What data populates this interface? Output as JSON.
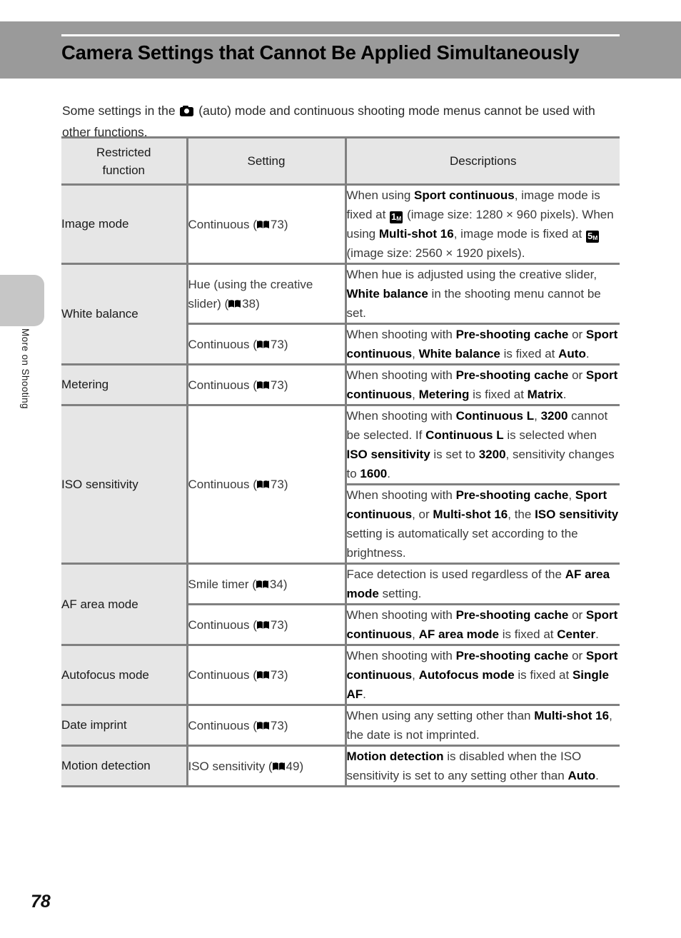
{
  "page": {
    "number": "78",
    "side_tab_label": "More on Shooting"
  },
  "header": {
    "title": "Camera Settings that Cannot Be Applied Simultaneously"
  },
  "intro": {
    "part1": "Some settings in the ",
    "icon": "camera-auto-icon",
    "part2": " (auto) mode and continuous shooting mode menus cannot be used with other functions."
  },
  "table": {
    "columns": [
      {
        "id": "restricted-function",
        "label_line1": "Restricted",
        "label_line2": "function"
      },
      {
        "id": "setting",
        "label": "Setting"
      },
      {
        "id": "descriptions",
        "label": "Descriptions"
      }
    ],
    "rows": [
      {
        "function": "Image mode",
        "entries": [
          {
            "setting": "Continuous (",
            "setting_ref": "73",
            "setting_suffix": ")",
            "description_id": "image-mode-desc"
          }
        ]
      },
      {
        "function": "White balance",
        "entries": [
          {
            "setting": "Hue (using the creative slider) (",
            "setting_ref": "38",
            "setting_suffix": ")",
            "description_id": "wb-hue-desc"
          },
          {
            "setting": "Continuous (",
            "setting_ref": "73",
            "setting_suffix": ")",
            "description_id": "wb-continuous-desc"
          }
        ]
      },
      {
        "function": "Metering",
        "entries": [
          {
            "setting": "Continuous (",
            "setting_ref": "73",
            "setting_suffix": ")",
            "description_id": "metering-desc"
          }
        ]
      },
      {
        "function": "ISO sensitivity",
        "entries": [
          {
            "setting": "Continuous (",
            "setting_ref": "73",
            "setting_suffix": ")",
            "description_id": "iso-desc-1"
          },
          {
            "description_id": "iso-desc-2"
          }
        ]
      },
      {
        "function": "AF area mode",
        "entries": [
          {
            "setting": "Smile timer (",
            "setting_ref": "34",
            "setting_suffix": ")",
            "description_id": "af-smile-desc"
          },
          {
            "setting": "Continuous (",
            "setting_ref": "73",
            "setting_suffix": ")",
            "description_id": "af-continuous-desc"
          }
        ]
      },
      {
        "function": "Autofocus mode",
        "entries": [
          {
            "setting": "Continuous (",
            "setting_ref": "73",
            "setting_suffix": ")",
            "description_id": "autofocus-desc"
          }
        ]
      },
      {
        "function": "Date imprint",
        "entries": [
          {
            "setting": "Continuous (",
            "setting_ref": "73",
            "setting_suffix": ")",
            "description_id": "date-imprint-desc"
          }
        ]
      },
      {
        "function": "Motion detection",
        "entries": [
          {
            "setting": "ISO sensitivity (",
            "setting_ref": "49",
            "setting_suffix": ")",
            "description_id": "motion-detection-desc"
          }
        ]
      }
    ]
  },
  "descriptions": {
    "image_mode": {
      "t1": "When using ",
      "b1": "Sport continuous",
      "t2": ", image mode is fixed at ",
      "badge1": "1",
      "badge1_unit": "M",
      "t3": " (image size: 1280 × 960 pixels). When using ",
      "b2": "Multi-shot 16",
      "t4": ", image mode is fixed at ",
      "badge2": "5",
      "badge2_unit": "M",
      "t5": " (image size: 2560 × 1920 pixels)."
    },
    "wb_hue": {
      "t1": "When hue is adjusted using the creative slider, ",
      "b1": "White balance",
      "t2": " in the shooting menu cannot be set."
    },
    "wb_continuous": {
      "t1": "When shooting with ",
      "b1": "Pre-shooting cache",
      "t2": " or ",
      "b2": "Sport continuous",
      "t3": ", ",
      "b3": "White balance",
      "t4": " is fixed at ",
      "b4": "Auto",
      "t5": "."
    },
    "metering": {
      "t1": "When shooting with ",
      "b1": "Pre-shooting cache",
      "t2": " or ",
      "b2": "Sport continuous",
      "t3": ", ",
      "b3": "Metering",
      "t4": " is fixed at ",
      "b4": "Matrix",
      "t5": "."
    },
    "iso_1": {
      "t1": "When shooting with ",
      "b1": "Continuous L",
      "t2": ", ",
      "b2": "3200",
      "t3": " cannot be selected. If ",
      "b3": "Continuous L",
      "t4": " is selected when ",
      "b4": "ISO sensitivity",
      "t5": " is set to ",
      "b5": "3200",
      "t6": ", sensitivity changes to ",
      "b6": "1600",
      "t7": "."
    },
    "iso_2": {
      "t1": "When shooting with ",
      "b1": "Pre-shooting cache",
      "t2": ", ",
      "b2": "Sport continuous",
      "t3": ", or ",
      "b3": "Multi-shot 16",
      "t4": ", the ",
      "b4": "ISO sensitivity",
      "t5": " setting is automatically set according to the brightness."
    },
    "af_smile": {
      "t1": "Face detection is used regardless of the ",
      "b1": "AF area mode",
      "t2": " setting."
    },
    "af_continuous": {
      "t1": "When shooting with ",
      "b1": "Pre-shooting cache",
      "t2": " or ",
      "b2": "Sport continuous",
      "t3": ", ",
      "b3": "AF area mode",
      "t4": " is fixed at ",
      "b4": "Center",
      "t5": "."
    },
    "autofocus": {
      "t1": "When shooting with ",
      "b1": "Pre-shooting cache",
      "t2": " or ",
      "b2": "Sport continuous",
      "t3": ", ",
      "b3": "Autofocus mode",
      "t4": " is fixed at ",
      "b4": "Single AF",
      "t5": "."
    },
    "date_imprint": {
      "t1": "When using any setting other than ",
      "b1": "Multi-shot 16",
      "t2": ", the date is not imprinted."
    },
    "motion_detection": {
      "b1": "Motion detection",
      "t1": " is disabled when the ISO sensitivity is set to any setting other than ",
      "b2": "Auto",
      "t2": "."
    }
  },
  "colors": {
    "header_band": "#9a9a9a",
    "table_rule": "#808080",
    "function_cell_bg": "#e6e6e6",
    "side_tab": "#c6c6c6"
  }
}
